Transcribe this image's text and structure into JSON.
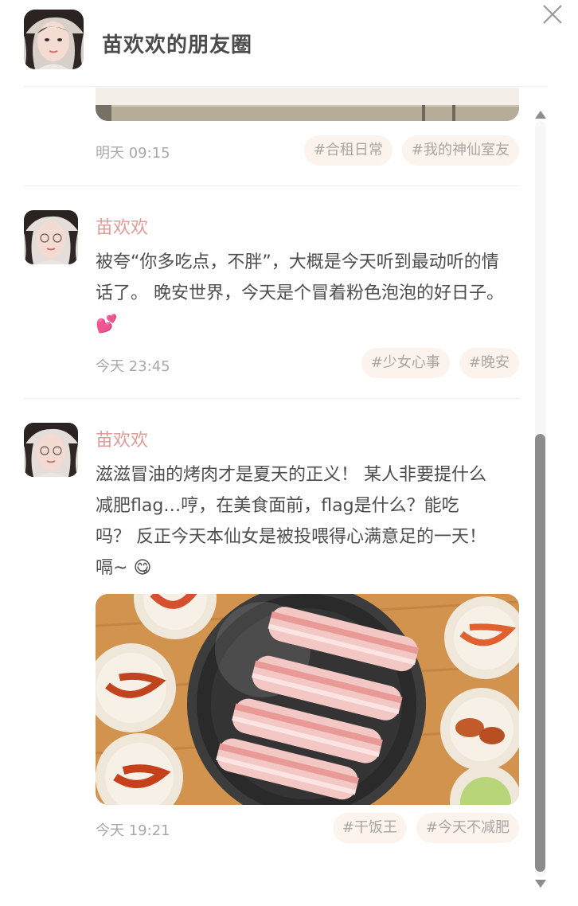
{
  "header": {
    "title": "苗欢欢的朋友圈"
  },
  "previous_post": {
    "time": "明天 09:15",
    "tags": [
      "#合租日常",
      "#我的神仙室友"
    ]
  },
  "posts": [
    {
      "author": "苗欢欢",
      "text": "被夸“你多吃点，不胖”，大概是今天听到最动听的情话了。 晚安世界，今天是个冒着粉色泡泡的好日子。",
      "emoji": "💕",
      "time": "今天 23:45",
      "tags": [
        "#少女心事",
        "#晚安"
      ]
    },
    {
      "author": "苗欢欢",
      "text": "滋滋冒油的烤肉才是夏天的正义！ 某人非要提什么减肥flag…哼，在美食面前，flag是什么？能吃吗？ 反正今天本仙女是被投喂得心满意足的一天！嗝~",
      "emoji": "😋",
      "time": "今天 19:21",
      "tags": [
        "#干饭王",
        "#今天不减肥"
      ]
    }
  ],
  "icons": {
    "close": "close-icon",
    "scroll_up": "triangle-up-icon",
    "scroll_down": "triangle-down-icon"
  },
  "colors": {
    "author": "#e29a98",
    "tag_bg": "#fbf3ec",
    "tag_text": "#a9a6a3",
    "time": "#a8a8a8",
    "scroll_thumb": "#8c8c8c"
  }
}
